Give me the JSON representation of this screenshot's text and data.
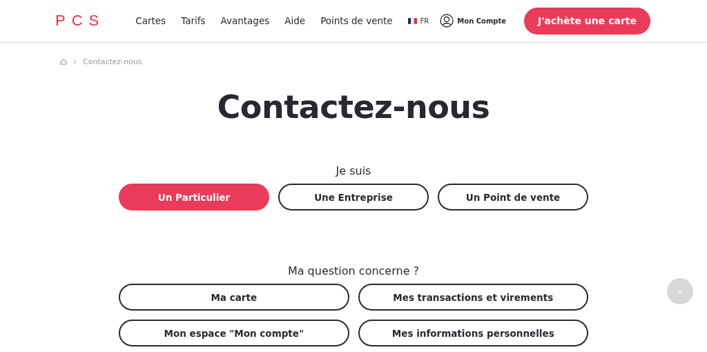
{
  "header": {
    "logo": "PCS",
    "nav": [
      "Cartes",
      "Tarifs",
      "Avantages",
      "Aide",
      "Points de vente"
    ],
    "language": "FR",
    "account": "Mon Compte",
    "cta": "J'achète une carte"
  },
  "breadcrumb": {
    "current": "Contactez-nous"
  },
  "title": "Contactez-nous",
  "profile": {
    "label": "Je suis",
    "options": [
      {
        "label": "Un Particulier",
        "selected": true
      },
      {
        "label": "Une Entreprise",
        "selected": false
      },
      {
        "label": "Un Point de vente",
        "selected": false
      }
    ]
  },
  "question": {
    "label": "Ma question concerne ?",
    "options": [
      {
        "label": "Ma carte",
        "selected": false
      },
      {
        "label": "Mes transactions et virements",
        "selected": false
      },
      {
        "label": "Mon espace \"Mon compte\"",
        "selected": false
      },
      {
        "label": "Mes informations personnelles",
        "selected": false
      }
    ]
  }
}
